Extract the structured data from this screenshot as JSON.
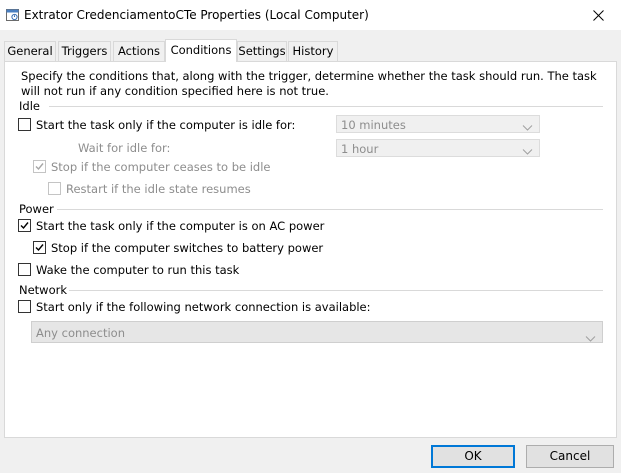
{
  "window": {
    "title": "Extrator CredenciamentoCTe Properties (Local Computer)"
  },
  "tabs": [
    {
      "label": "General"
    },
    {
      "label": "Triggers"
    },
    {
      "label": "Actions"
    },
    {
      "label": "Conditions"
    },
    {
      "label": "Settings"
    },
    {
      "label": "History"
    }
  ],
  "active_tab": "Conditions",
  "description": "Specify the conditions that, along with the trigger, determine whether the task should run.  The task will not run  if any condition specified here is not true.",
  "idle": {
    "group_label": "Idle",
    "start_if_idle": {
      "label": "Start the task only if the computer is idle for:",
      "checked": false
    },
    "idle_for": {
      "value": "10 minutes"
    },
    "wait_label": "Wait for idle for:",
    "wait_for": {
      "value": "1 hour"
    },
    "stop_if_ceases": {
      "label": "Stop if the computer ceases to be idle",
      "checked": true
    },
    "restart_if_resumes": {
      "label": "Restart if the idle state resumes",
      "checked": false
    }
  },
  "power": {
    "group_label": "Power",
    "ac_power": {
      "label": "Start the task only if the computer is on AC power",
      "checked": true
    },
    "stop_on_battery": {
      "label": "Stop if the computer switches to battery power",
      "checked": true
    },
    "wake": {
      "label": "Wake the computer to run this task",
      "checked": false
    }
  },
  "network": {
    "group_label": "Network",
    "start_if_available": {
      "label": "Start only if the following network connection is available:",
      "checked": false
    },
    "connection": {
      "value": "Any connection"
    }
  },
  "buttons": {
    "ok": "OK",
    "cancel": "Cancel"
  }
}
